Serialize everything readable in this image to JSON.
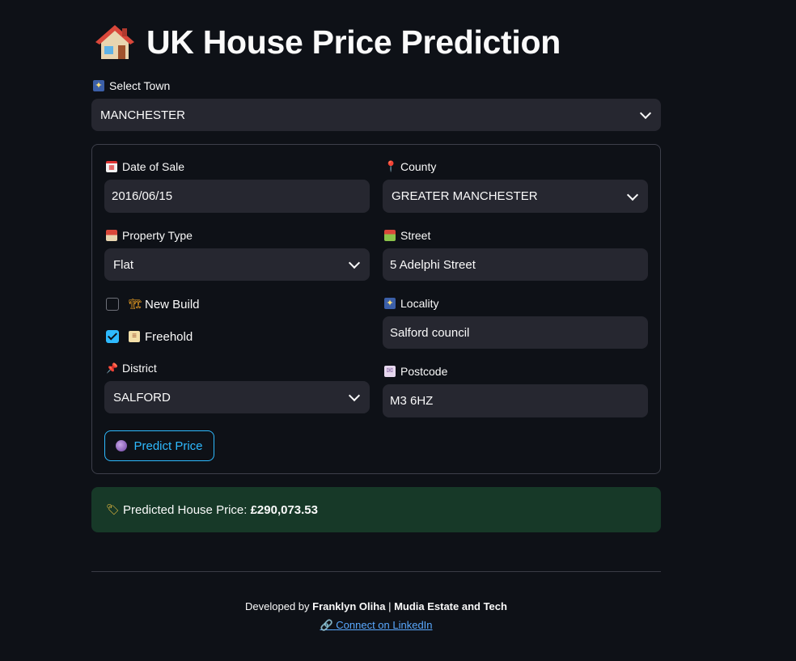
{
  "header": {
    "title": "UK House Price Prediction",
    "icon": "house-icon"
  },
  "town": {
    "label": "Select Town",
    "icon": "cityscape-icon",
    "value": "MANCHESTER"
  },
  "form": {
    "date_of_sale": {
      "label": "Date of Sale",
      "icon": "calendar-icon",
      "value": "2016/06/15"
    },
    "county": {
      "label": "County",
      "icon": "pin-icon",
      "value": "GREATER MANCHESTER"
    },
    "property_type": {
      "label": "Property Type",
      "icon": "house-icon",
      "value": "Flat"
    },
    "street": {
      "label": "Street",
      "icon": "houses-icon",
      "value": "5 Adelphi Street"
    },
    "new_build": {
      "label": "New Build",
      "icon": "construction-icon",
      "checked": false
    },
    "freehold": {
      "label": "Freehold",
      "icon": "scroll-icon",
      "checked": true
    },
    "locality": {
      "label": "Locality",
      "icon": "cityscape-icon",
      "value": "Salford council"
    },
    "district": {
      "label": "District",
      "icon": "pushpin-icon",
      "value": "SALFORD"
    },
    "postcode": {
      "label": "Postcode",
      "icon": "envelope-icon",
      "value": "M3 6HZ"
    },
    "predict_button": {
      "label": "Predict Price",
      "icon": "crystal-ball-icon"
    }
  },
  "result": {
    "icon": "tag-icon",
    "prefix": "Predicted House Price: ",
    "value": "£290,073.53"
  },
  "footer": {
    "developed_by": "Developed by ",
    "author": "Franklyn Oliha",
    "separator": " | ",
    "company": "Mudia Estate and Tech",
    "link_icon": "link-icon",
    "link_text": "Connect on LinkedIn"
  },
  "colors": {
    "background": "#0e1117",
    "field": "#262730",
    "accent": "#2ebaff",
    "success_bg": "#173928",
    "link": "#5aa9ff"
  }
}
